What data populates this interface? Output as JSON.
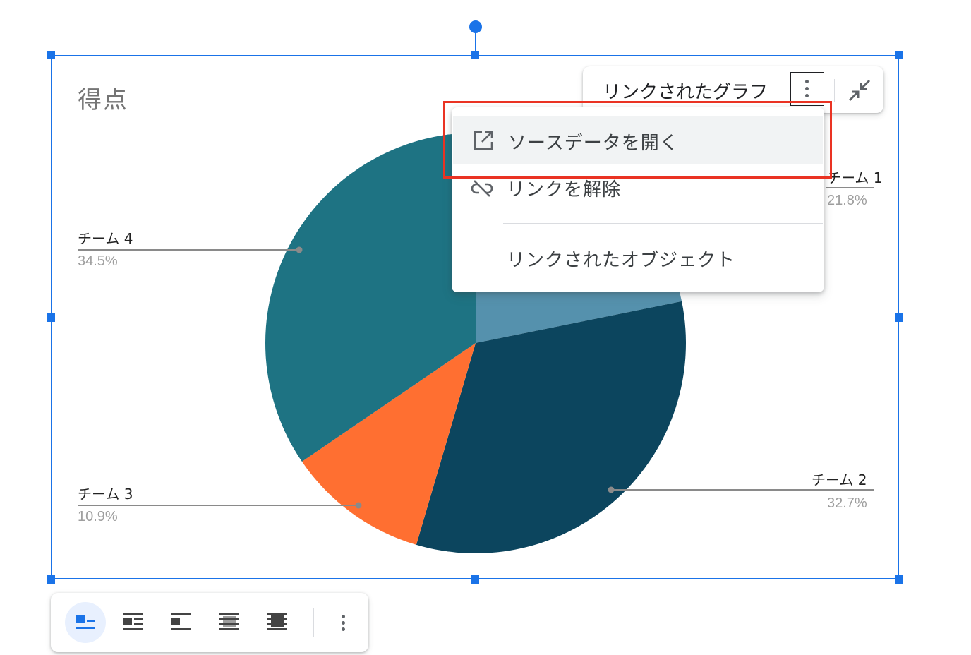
{
  "chart": {
    "title": "得点",
    "slices": [
      {
        "label": "チーム 1",
        "percent": "21.8%",
        "value": 21.8,
        "color": "#5591ad"
      },
      {
        "label": "チーム 2",
        "percent": "32.7%",
        "value": 32.7,
        "color": "#0c455e"
      },
      {
        "label": "チーム 3",
        "percent": "10.9%",
        "value": 10.9,
        "color": "#ff6f31"
      },
      {
        "label": "チーム 4",
        "percent": "34.5%",
        "value": 34.5,
        "color": "#1e7383"
      }
    ]
  },
  "linked_toolbar": {
    "label": "リンクされたグラフ",
    "more_icon": "more-vert-icon",
    "collapse_icon": "collapse-icon"
  },
  "menu": {
    "items": [
      {
        "label": "ソースデータを開く",
        "icon": "open-in-new-icon",
        "highlighted": true
      },
      {
        "label": "リンクを解除",
        "icon": "link-off-icon"
      },
      {
        "label": "リンクされたオブジェクト"
      }
    ]
  },
  "wrap_toolbar": {
    "buttons": [
      {
        "icon": "wrap-inline-icon",
        "active": true
      },
      {
        "icon": "wrap-text-icon"
      },
      {
        "icon": "break-text-icon"
      },
      {
        "icon": "behind-text-icon"
      },
      {
        "icon": "in-front-of-text-icon"
      }
    ],
    "more_icon": "more-vert-icon"
  },
  "colors": {
    "selection": "#1a73e8",
    "highlight": "#ea3323"
  }
}
